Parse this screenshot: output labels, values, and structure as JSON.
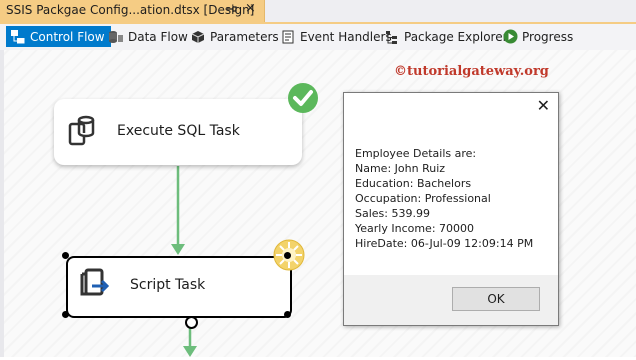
{
  "document_tab": {
    "title": "SSIS Packgae Config...ation.dtsx [Design]",
    "pin_icon": "pin-icon",
    "close_glyph": "×"
  },
  "designer_tabs": [
    {
      "label": "Control Flow",
      "icon": "control-flow-icon",
      "active": true
    },
    {
      "label": "Data Flow",
      "icon": "data-flow-icon",
      "active": false
    },
    {
      "label": "Parameters",
      "icon": "parameters-icon",
      "active": false
    },
    {
      "label": "Event Handlers",
      "icon": "event-handlers-icon",
      "active": false
    },
    {
      "label": "Package Explorer",
      "icon": "package-explorer-icon",
      "active": false
    },
    {
      "label": "Progress",
      "icon": "progress-icon",
      "active": false
    }
  ],
  "watermark": "©tutorialgateway.org",
  "tasks": {
    "execute_sql": {
      "label": "Execute SQL Task",
      "status": "success"
    },
    "script": {
      "label": "Script Task",
      "status": "running"
    }
  },
  "message_box": {
    "close_glyph": "✕",
    "lines": [
      "Employee Details are:",
      "Name: John Ruiz",
      "Education: Bachelors",
      "Occupation: Professional",
      "Sales: 539.99",
      "Yearly Income: 70000",
      "HireDate: 06-Jul-09 12:09:14 PM"
    ],
    "ok_label": "OK"
  },
  "colors": {
    "accent": "#007acc",
    "tab_gold": "#f5cc84",
    "success_green": "#5cb85c",
    "connector_green": "#6dbd7c",
    "running_yellow": "#f3d36a",
    "watermark_red": "#c0392b"
  }
}
